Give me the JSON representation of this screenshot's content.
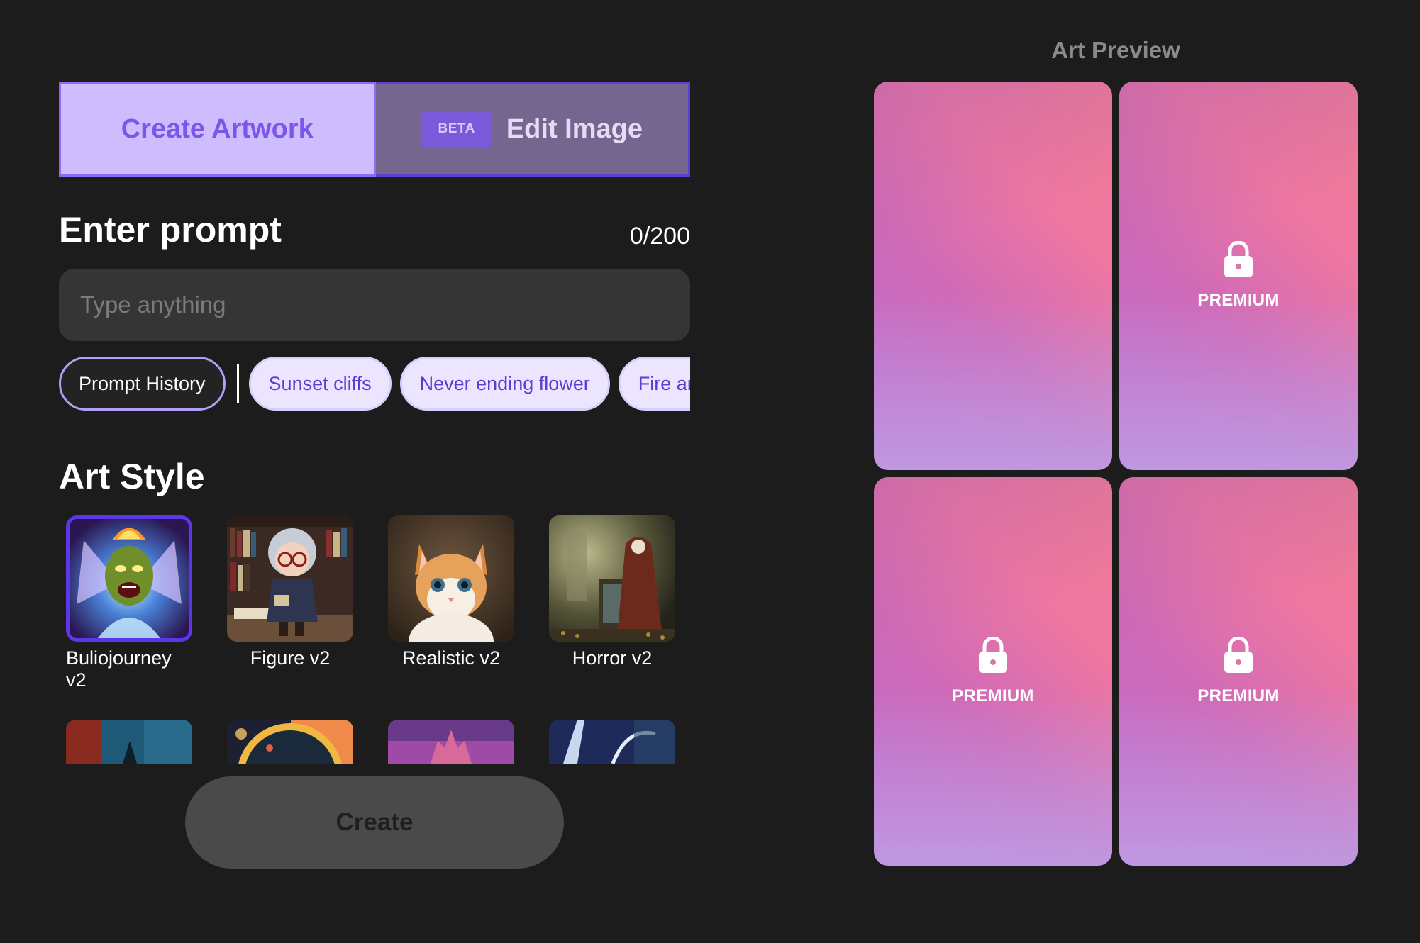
{
  "tabs": {
    "create_label": "Create Artwork",
    "edit_badge": "BETA",
    "edit_label": "Edit Image"
  },
  "prompt": {
    "title": "Enter prompt",
    "counter": "0/200",
    "placeholder": "Type anything",
    "value": ""
  },
  "chips": {
    "history_label": "Prompt History",
    "suggestions": [
      "Sunset cliffs",
      "Never ending flower",
      "Fire and w"
    ]
  },
  "art_style": {
    "title": "Art Style",
    "styles": [
      {
        "label": "Buliojourney v2",
        "selected": true
      },
      {
        "label": "Figure v2",
        "selected": false
      },
      {
        "label": "Realistic v2",
        "selected": false
      },
      {
        "label": "Horror v2",
        "selected": false
      }
    ]
  },
  "create_button": {
    "label": "Create"
  },
  "preview": {
    "title": "Art Preview",
    "cards": [
      {
        "locked": false,
        "label": ""
      },
      {
        "locked": true,
        "label": "PREMIUM"
      },
      {
        "locked": true,
        "label": "PREMIUM"
      },
      {
        "locked": true,
        "label": "PREMIUM"
      }
    ]
  },
  "colors": {
    "background": "#1c1c1c",
    "accent": "#7d55e8",
    "tab_active_bg": "#cdbdfe",
    "tab_inactive_bg": "#74668f",
    "chip_bg": "#ebe5ff",
    "selected_border": "#5b36ea",
    "create_button_bg": "#4a4a4a"
  }
}
